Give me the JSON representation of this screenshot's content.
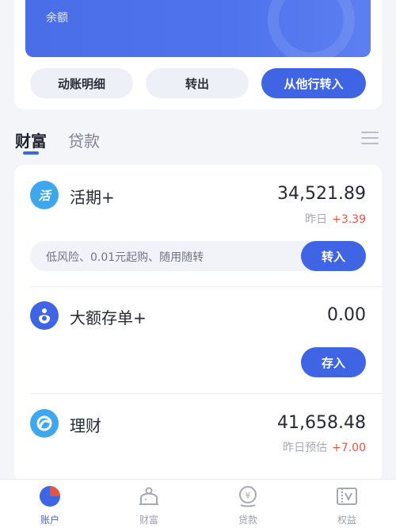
{
  "balance_card": {
    "label": "余额"
  },
  "actions": {
    "flow_details": "动账明细",
    "transfer_out": "转出",
    "transfer_in_from_other": "从他行转入"
  },
  "section_tabs": [
    {
      "label": "财富",
      "active": true
    },
    {
      "label": "贷款",
      "active": false
    }
  ],
  "products": [
    {
      "name": "活期+",
      "icon": "huo-icon",
      "icon_text": "活",
      "amount": "34,521.89",
      "sub_label": "昨日",
      "sub_delta": "+3.39",
      "tip": "低风险、0.01元起购、随用随转",
      "button": "转入"
    },
    {
      "name": "大额存单+",
      "icon": "deposit-certificate-icon",
      "amount": "0.00",
      "button": "存入"
    },
    {
      "name": "理财",
      "icon": "wealth-management-icon",
      "amount": "41,658.48",
      "sub_label": "昨日预估",
      "sub_delta": "+7.00"
    }
  ],
  "bottom_nav": [
    {
      "label": "账户",
      "icon": "account-pie-icon",
      "active": true
    },
    {
      "label": "财富",
      "icon": "wealth-piggy-icon",
      "active": false
    },
    {
      "label": "贷款",
      "icon": "loan-coin-icon",
      "active": false
    },
    {
      "label": "权益",
      "icon": "benefits-ticket-icon",
      "active": false
    }
  ],
  "colors": {
    "accent": "#3f64e4",
    "card_blue": "#4f73ec",
    "positive_delta": "#e4553f",
    "page_bg": "#f4f5f9"
  }
}
